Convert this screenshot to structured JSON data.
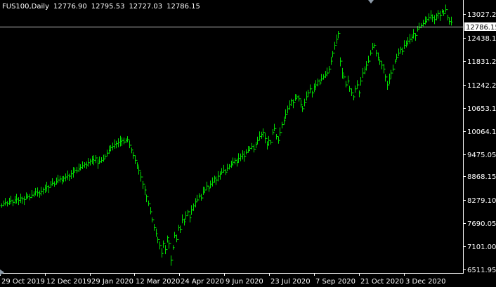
{
  "header": {
    "symbol": "FUS100,Daily",
    "open": "12776.90",
    "high": "12795.53",
    "low": "12727.03",
    "close": "12786.15"
  },
  "current_price_label": "12786.15",
  "colors": {
    "background": "#000000",
    "bars": "#00e000",
    "axis": "#ffffff",
    "price_line": "#c0c0c0",
    "marker": "#8c9aa8"
  },
  "chart_data": {
    "type": "bar",
    "instrument": "FUS100",
    "timeframe": "Daily",
    "y_ticks": [
      "13027.20",
      "12438.15",
      "11831.25",
      "11242.20",
      "10653.15",
      "10064.10",
      "9475.05",
      "8868.15",
      "8279.10",
      "7690.05",
      "7101.00",
      "6511.95"
    ],
    "x_ticks": [
      "29 Oct 2019",
      "12 Dec 2019",
      "29 Jan 2020",
      "12 Mar 2020",
      "24 Apr 2020",
      "9 Jun 2020",
      "23 Jul 2020",
      "7 Sep 2020",
      "21 Oct 2020",
      "3 Dec 2020"
    ],
    "ylim": [
      6512,
      13200
    ],
    "series": [
      {
        "values": [
          8160,
          8200,
          8230,
          8210,
          8260,
          8280,
          8240,
          8300,
          8320,
          8290,
          8350,
          8330,
          8310,
          8370,
          8390,
          8360,
          8420,
          8450,
          8500,
          8480,
          8460,
          8520,
          8560,
          8600,
          8640,
          8610,
          8680,
          8720,
          8700,
          8760,
          8800,
          8830,
          8790,
          8850,
          8880,
          8920,
          8900,
          8960,
          9000,
          9050,
          9030,
          9080,
          9120,
          9160,
          9200,
          9180,
          9240,
          9280,
          9320,
          9300,
          9360,
          9220,
          9260,
          9300,
          9330,
          9400,
          9480,
          9550,
          9620,
          9650,
          9700,
          9720,
          9750,
          9780,
          9800,
          9760,
          9800,
          9820,
          9680,
          9560,
          9420,
          9300,
          9180,
          9050,
          8880,
          8700,
          8550,
          8380,
          8200,
          8000,
          7800,
          7600,
          7450,
          7300,
          7150,
          6950,
          7200,
          7050,
          7350,
          7200,
          6780,
          7100,
          7400,
          7300,
          7600,
          7550,
          7800,
          7750,
          7900,
          8000,
          7850,
          8050,
          8150,
          8250,
          8300,
          8400,
          8350,
          8500,
          8550,
          8650,
          8600,
          8700,
          8750,
          8850,
          8800,
          8900,
          8950,
          9000,
          9050,
          9000,
          9100,
          9150,
          9200,
          9250,
          9300,
          9250,
          9350,
          9400,
          9450,
          9400,
          9500,
          9550,
          9600,
          9650,
          9580,
          9700,
          9800,
          9900,
          9950,
          10000,
          9850,
          9700,
          9800,
          9750,
          10000,
          10100,
          9900,
          9800,
          10000,
          10200,
          10300,
          10450,
          10600,
          10700,
          10800,
          10750,
          10850,
          10900,
          10850,
          10700,
          10600,
          10750,
          10900,
          11000,
          11100,
          11000,
          11150,
          11200,
          11300,
          11250,
          11350,
          11400,
          11450,
          11500,
          11600,
          11800,
          12000,
          12200,
          12350,
          12500,
          11800,
          11500,
          11400,
          11200,
          11300,
          11100,
          11000,
          10900,
          11100,
          11200,
          11000,
          11300,
          11500,
          11600,
          11700,
          11800,
          12000,
          12150,
          12200,
          12000,
          11900,
          11800,
          11700,
          11600,
          11400,
          11200,
          11350,
          11500,
          11600,
          11800,
          11900,
          12000,
          12100,
          12050,
          12200,
          12250,
          12300,
          12350,
          12400,
          12500,
          12450,
          12600,
          12650,
          12700,
          12750,
          12800,
          12850,
          12900,
          12950,
          12900,
          12850,
          12950,
          13000,
          12950,
          13050,
          13000,
          13100,
          12900,
          12800,
          12786
        ]
      }
    ]
  }
}
